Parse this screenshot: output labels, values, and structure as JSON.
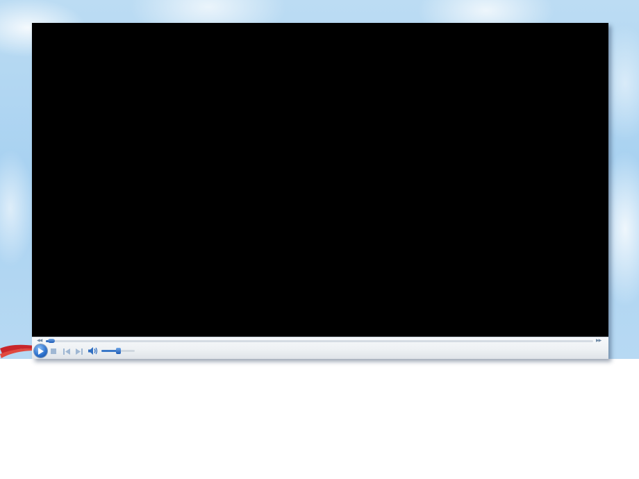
{
  "player": {
    "seek_progress": 0.01,
    "volume_level": 0.5,
    "accent_color": "#2f6ec1",
    "screen_color": "#000000",
    "icons": {
      "play": "play-icon",
      "stop": "stop-icon",
      "previous": "previous-icon",
      "next": "next-icon",
      "volume": "speaker-icon",
      "seek_back": "rewind-icon",
      "seek_forward": "fast-forward-icon"
    }
  }
}
